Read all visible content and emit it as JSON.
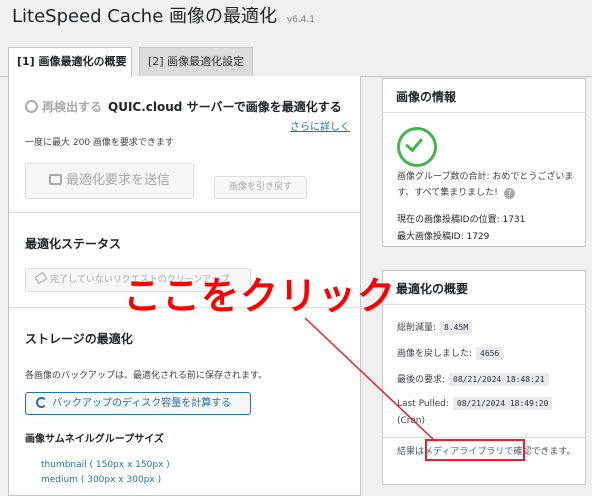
{
  "header": {
    "title": "LiteSpeed Cache 画像の最適化",
    "version": "v6.4.1"
  },
  "tabs": [
    {
      "label": "[1] 画像最適化の概要"
    },
    {
      "label": "[2] 画像最適化設定"
    }
  ],
  "pull": {
    "icon": "refresh-icon",
    "muted_label": "再検出する",
    "title": "QUIC.cloud サーバーで画像を最適化する",
    "more_link": "さらに詳しく",
    "quota_text": "一度に最大 200 画像を要求できます",
    "send_button": "最適化要求を送信",
    "revert_button": "画像を引き戻す"
  },
  "status": {
    "heading": "最適化ステータス",
    "clean_button": "完了していないリクエストのクリーンアップ"
  },
  "storage": {
    "heading": "ストレージの最適化",
    "backup_text": "各画像のバックアップは、最適化される前に保存されます。",
    "calc_button": "バックアップのディスク容量を計算する",
    "thumb_heading": "画像サムネイルグループサイズ",
    "sizes": [
      "thumbnail ( 150px x 150px )",
      "medium ( 300px x 300px )"
    ]
  },
  "info": {
    "heading": "画像の情報",
    "congrats": "画像グループ数の合計: おめでとうございます、すべて集まりました!",
    "help_icon": "?",
    "current_id": "現在の画像投稿IDの位置: 1731",
    "max_id": "最大画像投稿ID: 1729"
  },
  "summary": {
    "heading": "最適化の概要",
    "reduced_label": "総削減量:",
    "reduced_value": "8.45M",
    "restored_label": "画像を戻しました:",
    "restored_value": "4656",
    "last_request_label": "最後の要求:",
    "last_request_value": "08/21/2024 18:48:21",
    "last_pulled_label": "Last Pulled:",
    "last_pulled_value": "08/21/2024 18:49:20",
    "cron_label": "(Cron)",
    "result_prefix": "結果は",
    "result_link": "メディアライブラリで",
    "result_suffix": "確認できます。"
  },
  "annotation": {
    "text": "ここをクリック",
    "color": "#ff0000"
  }
}
